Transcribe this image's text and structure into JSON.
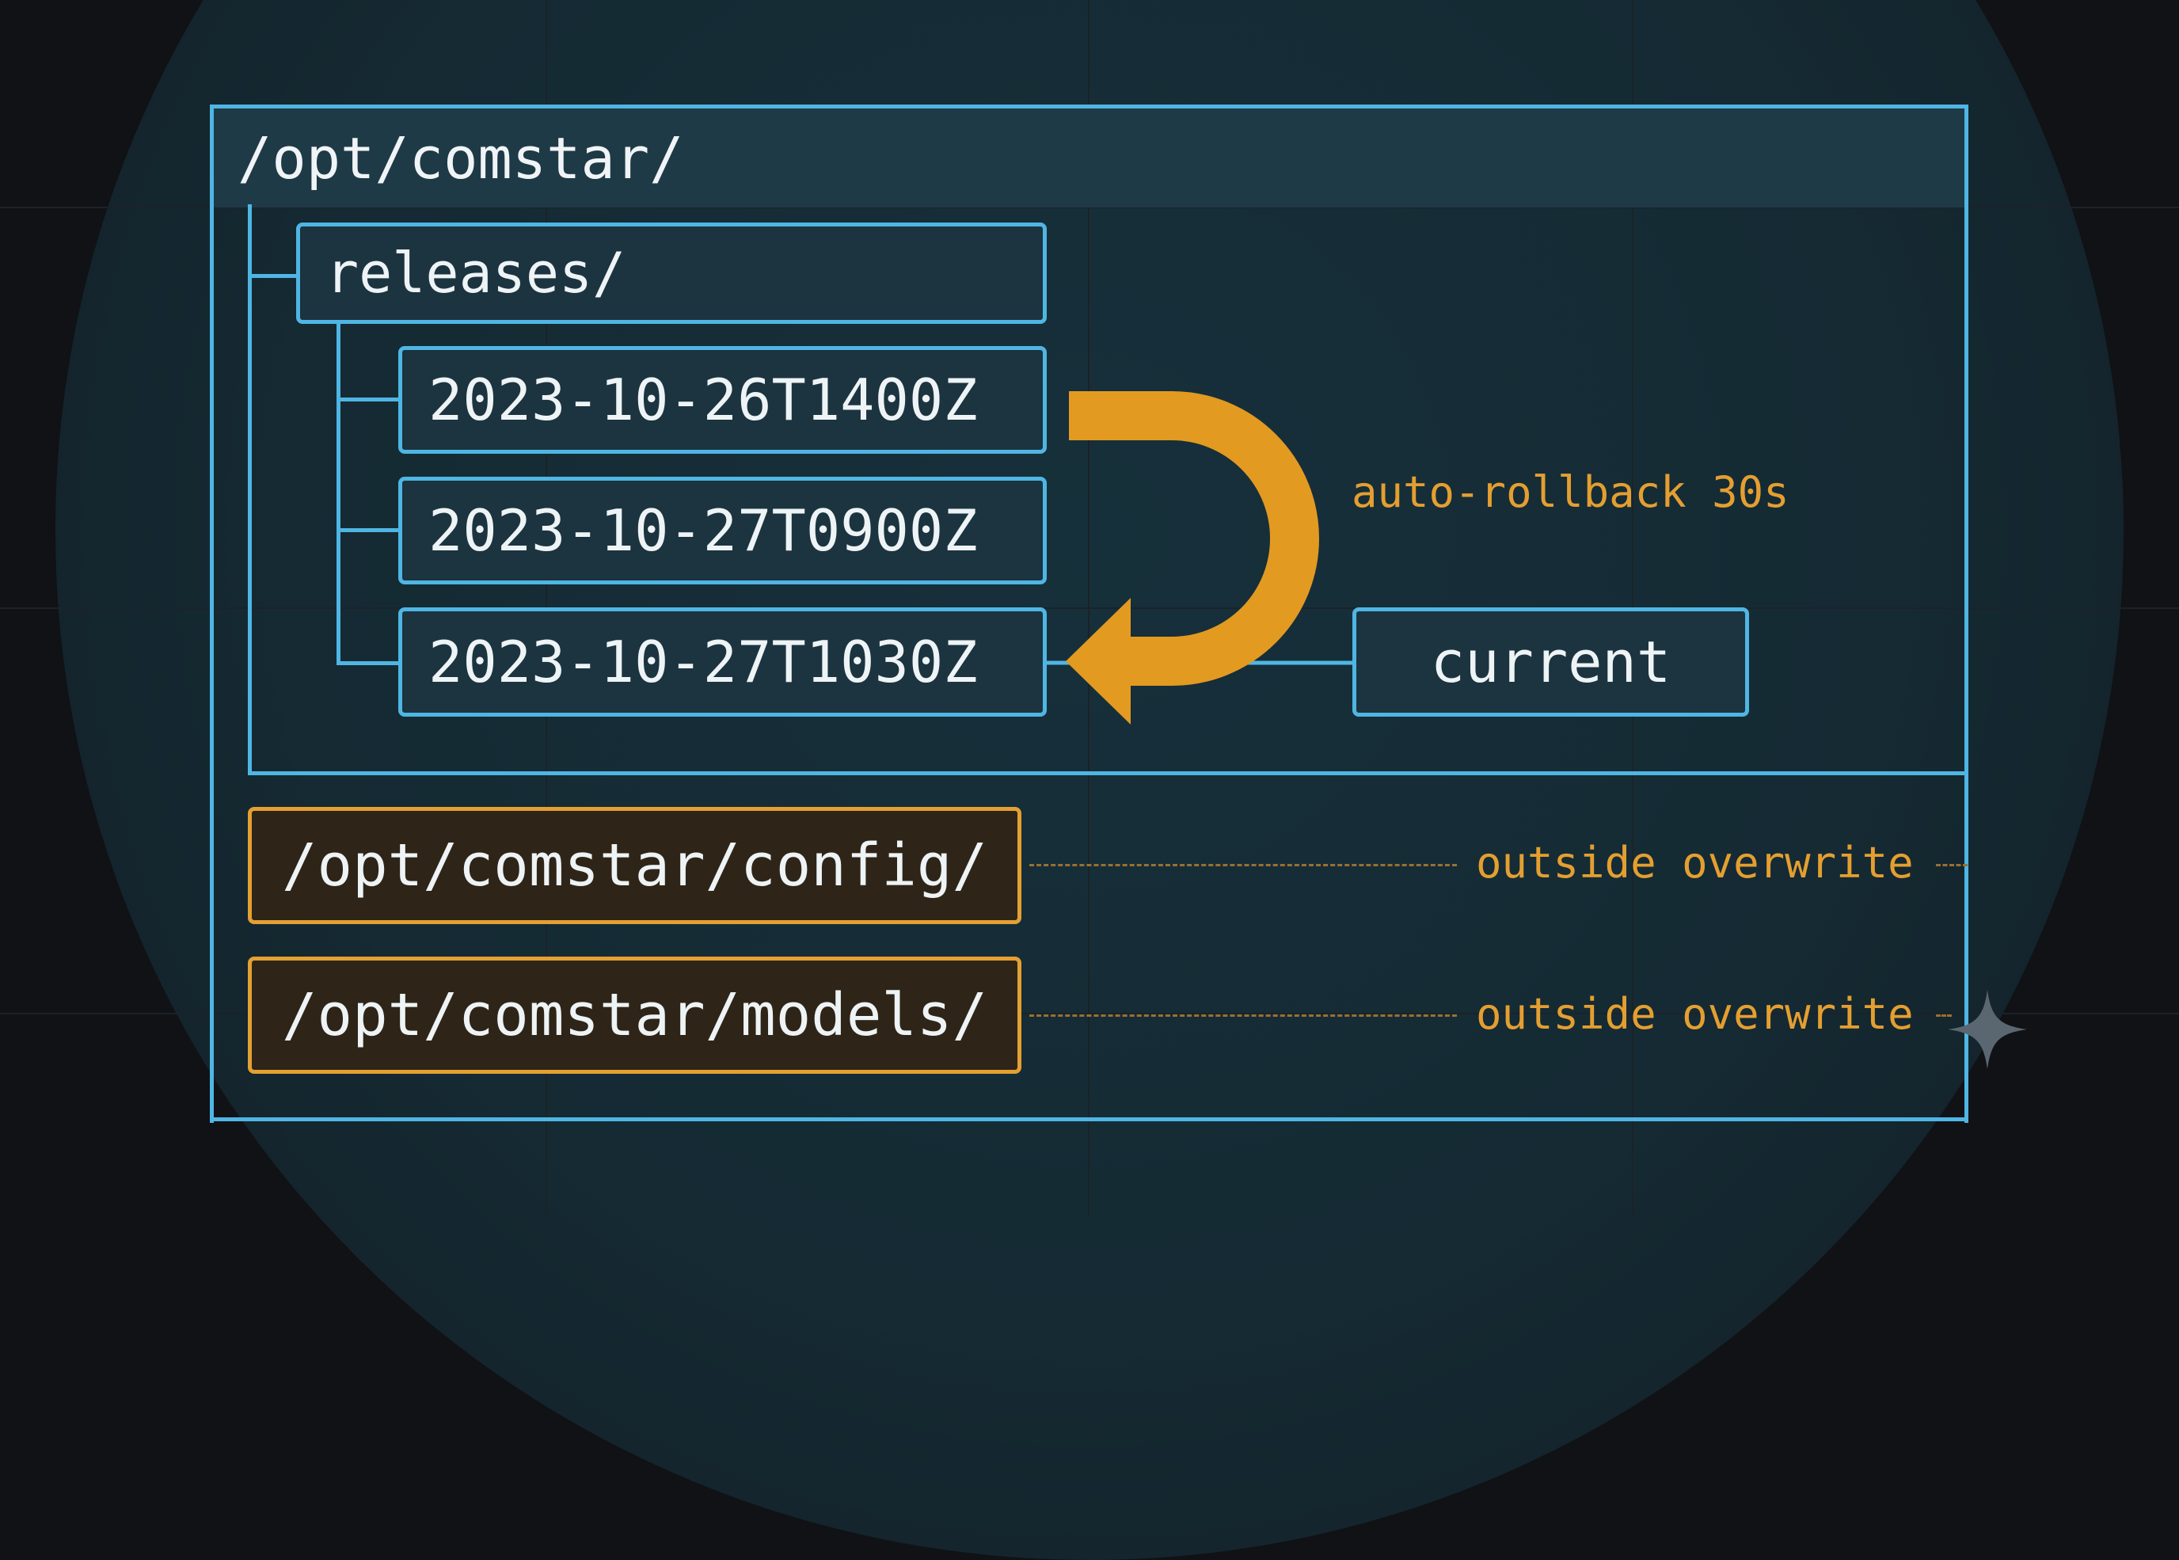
{
  "root": {
    "label": "/opt/comstar/"
  },
  "releases": {
    "label": "releases/",
    "items": [
      {
        "label": "2023-10-26T1400Z"
      },
      {
        "label": "2023-10-27T0900Z"
      },
      {
        "label": "2023-10-27T1030Z"
      }
    ]
  },
  "current": {
    "label": "current"
  },
  "rollback": {
    "label": "auto-rollback 30s"
  },
  "persistent": [
    {
      "label": "/opt/comstar/config/",
      "note": "outside overwrite"
    },
    {
      "label": "/opt/comstar/models/",
      "note": "outside overwrite"
    }
  ],
  "colors": {
    "frame": "#4fb6e4",
    "accent": "#e4a032",
    "background": "#101216"
  },
  "icons": {
    "corner": "sparkle-icon"
  }
}
